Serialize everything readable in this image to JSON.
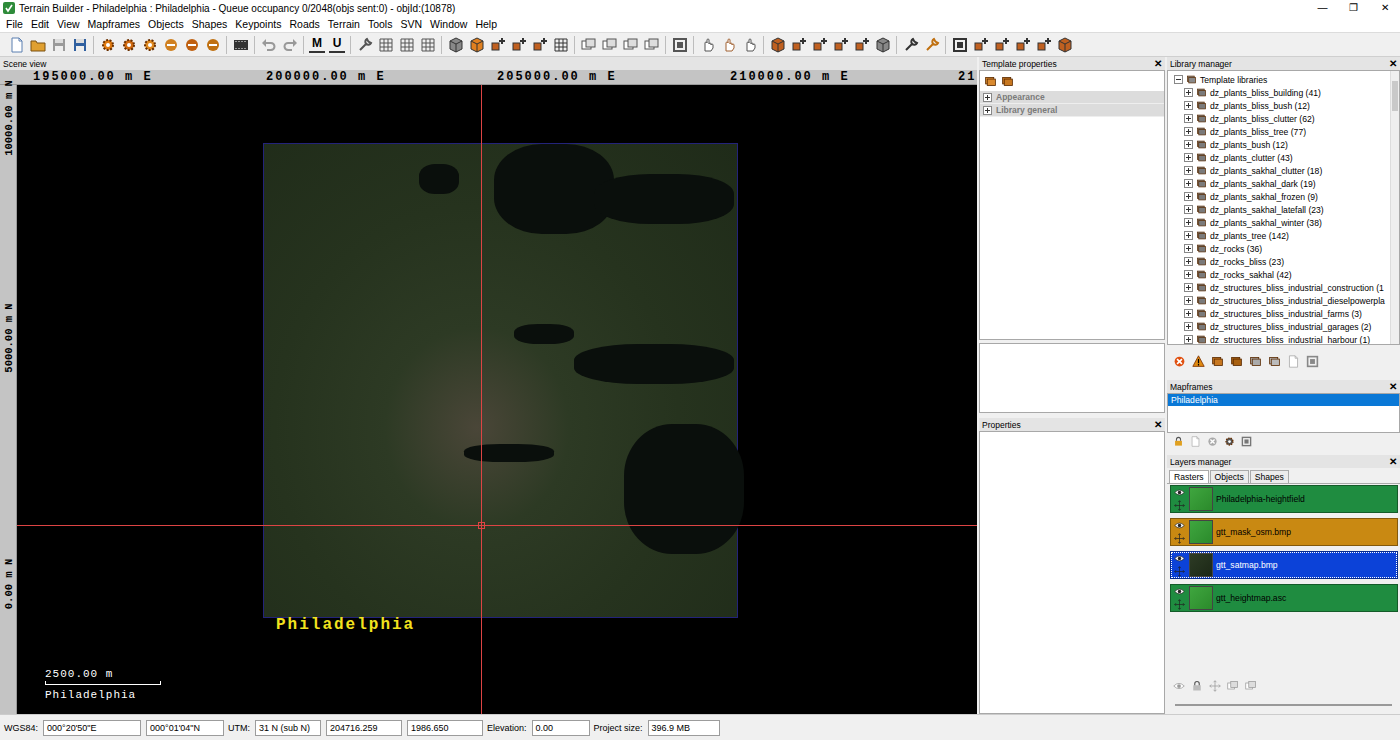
{
  "window": {
    "title": "Terrain Builder - Philadelphia : Philadelphia - Queue occupancy 0/2048(objs sent:0) - objId:(10878)",
    "controls": [
      "—",
      "❐",
      "✕"
    ]
  },
  "menu": [
    "File",
    "Edit",
    "View",
    "Mapframes",
    "Objects",
    "Shapes",
    "Keypoints",
    "Roads",
    "Terrain",
    "Tools",
    "SVN",
    "Window",
    "Help"
  ],
  "toolbar": {
    "letter_buttons": [
      "M",
      "U"
    ]
  },
  "scene": {
    "title": "Scene view",
    "ruler_top": [
      "195000.00 m E",
      "200000.00 m E",
      "205000.00 m E",
      "210000.00 m E",
      "21"
    ],
    "ruler_left": [
      "10000.00 m N",
      "5000.00 m N",
      "0.00 m N"
    ],
    "map_label": "Philadelphia",
    "scale": {
      "distance": "2500.00 m",
      "name": "Philadelphia"
    }
  },
  "template_properties": {
    "title": "Template properties",
    "close": "✕",
    "sections": [
      {
        "label": "Appearance",
        "expanded": false,
        "disabled": true
      },
      {
        "label": "Library general",
        "expanded": false,
        "disabled": true
      }
    ]
  },
  "properties": {
    "title": "Properties",
    "close": "✕"
  },
  "library": {
    "title": "Library manager",
    "close": "✕",
    "root": {
      "label": "Template libraries",
      "expanded": true
    },
    "items": [
      {
        "label": "dz_plants_bliss_building (41)",
        "expanded": false
      },
      {
        "label": "dz_plants_bliss_bush (12)",
        "expanded": false
      },
      {
        "label": "dz_plants_bliss_clutter (62)",
        "expanded": false
      },
      {
        "label": "dz_plants_bliss_tree (77)",
        "expanded": false
      },
      {
        "label": "dz_plants_bush (12)",
        "expanded": false
      },
      {
        "label": "dz_plants_clutter (43)",
        "expanded": false
      },
      {
        "label": "dz_plants_sakhal_clutter (18)",
        "expanded": false
      },
      {
        "label": "dz_plants_sakhal_dark (19)",
        "expanded": false
      },
      {
        "label": "dz_plants_sakhal_frozen (9)",
        "expanded": false
      },
      {
        "label": "dz_plants_sakhal_latefall (23)",
        "expanded": false
      },
      {
        "label": "dz_plants_sakhal_winter (38)",
        "expanded": false
      },
      {
        "label": "dz_plants_tree (142)",
        "expanded": false
      },
      {
        "label": "dz_rocks (36)",
        "expanded": false
      },
      {
        "label": "dz_rocks_bliss (23)",
        "expanded": false
      },
      {
        "label": "dz_rocks_sakhal (42)",
        "expanded": false
      },
      {
        "label": "dz_structures_bliss_industrial_construction (1",
        "expanded": false
      },
      {
        "label": "dz_structures_bliss_industrial_dieselpowerpla",
        "expanded": false
      },
      {
        "label": "dz_structures_bliss_industrial_farms (3)",
        "expanded": false
      },
      {
        "label": "dz_structures_bliss_industrial_garages (2)",
        "expanded": false
      },
      {
        "label": "dz_structures_bliss_industrial_harbour (1)",
        "expanded": false
      }
    ]
  },
  "mapframes": {
    "title": "Mapframes",
    "close": "✕",
    "items": [
      {
        "label": "Philadelphia",
        "selected": true
      }
    ]
  },
  "layers": {
    "title": "Layers manager",
    "close": "✕",
    "tabs": [
      {
        "label": "Rasters",
        "selected": true
      },
      {
        "label": "Objects",
        "selected": false
      },
      {
        "label": "Shapes",
        "selected": false
      }
    ],
    "rows": [
      {
        "name": "Philadelphia-heightfield",
        "visible": true,
        "selected": false,
        "color": "#1f8c40"
      },
      {
        "name": "gtt_mask_osm.bmp",
        "visible": true,
        "selected": false,
        "color": "#c98912"
      },
      {
        "name": "gtt_satmap.bmp",
        "visible": true,
        "selected": true,
        "color": "#0c42d8"
      },
      {
        "name": "gtt_heightmap.asc",
        "visible": true,
        "selected": false,
        "color": "#1f8c40"
      }
    ]
  },
  "status_bar": {
    "groups": [
      {
        "label": "WGS84:",
        "values": [
          "000°20'50\"E",
          "000°01'04\"N"
        ]
      },
      {
        "label": "UTM:",
        "values": [
          "31 N (sub N)",
          "204716.259",
          "1986.650"
        ]
      },
      {
        "label": "Elevation:",
        "values": [
          "0.00"
        ]
      },
      {
        "label": "Project size:",
        "values": [
          "396.9 MB"
        ]
      }
    ]
  }
}
